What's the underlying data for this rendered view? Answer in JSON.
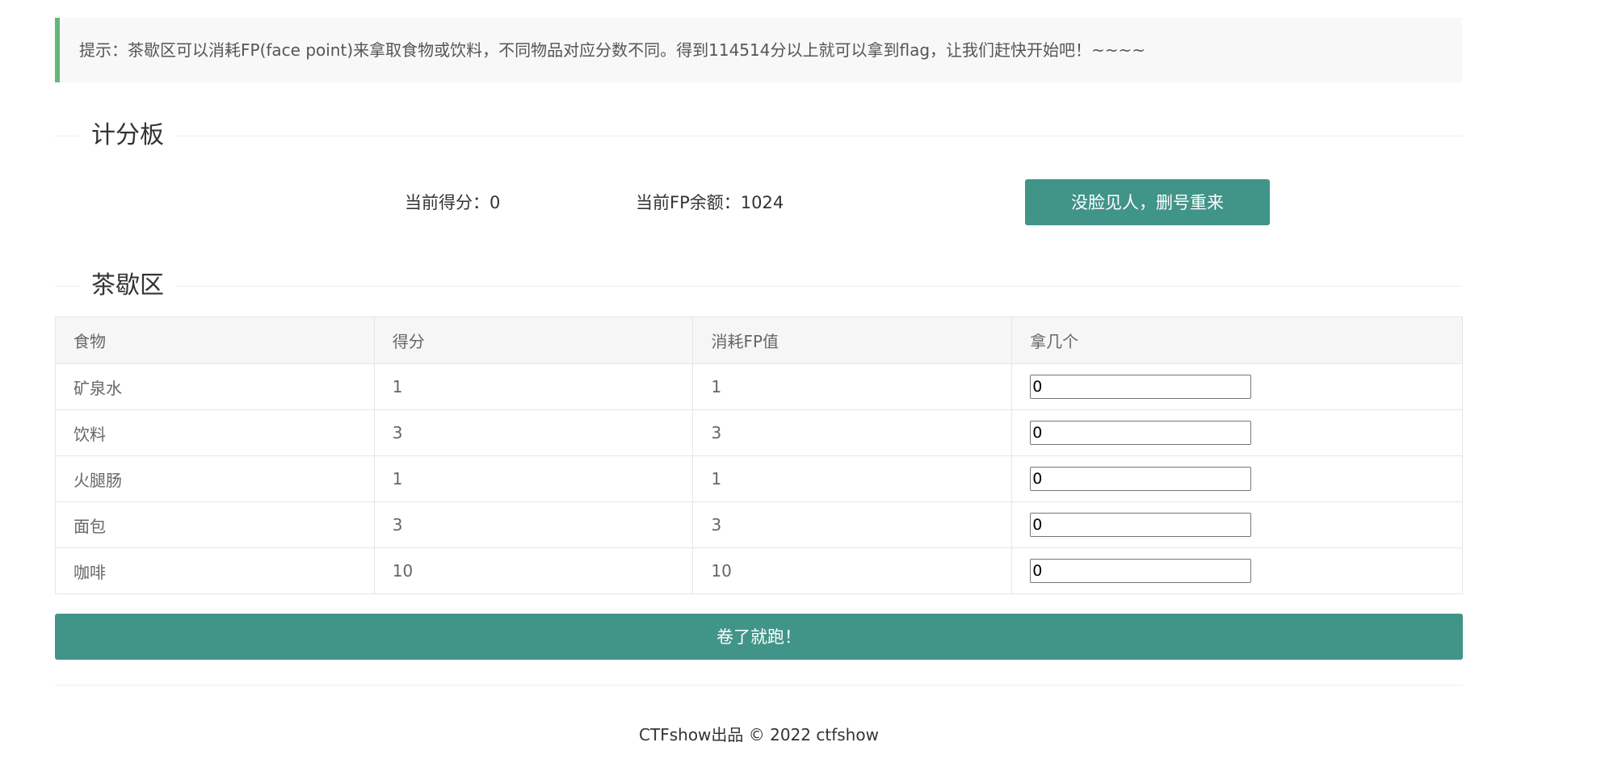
{
  "tip": {
    "text": "提示：茶歇区可以消耗FP(face point)来拿取食物或饮料，不同物品对应分数不同。得到114514分以上就可以拿到flag，让我们赶快开始吧！~~~~"
  },
  "scoreboard": {
    "title": "计分板",
    "current_score": "当前得分：0",
    "current_fp": "当前FP余额：1024",
    "reset_label": "没脸见人，删号重来"
  },
  "break_area": {
    "title": "茶歇区",
    "headers": [
      "食物",
      "得分",
      "消耗FP值",
      "拿几个"
    ],
    "rows": [
      {
        "food": "矿泉水",
        "score": "1",
        "fp": "1",
        "qty": "0"
      },
      {
        "food": "饮料",
        "score": "3",
        "fp": "3",
        "qty": "0"
      },
      {
        "food": "火腿肠",
        "score": "1",
        "fp": "1",
        "qty": "0"
      },
      {
        "food": "面包",
        "score": "3",
        "fp": "3",
        "qty": "0"
      },
      {
        "food": "咖啡",
        "score": "10",
        "fp": "10",
        "qty": "0"
      }
    ],
    "submit_label": "卷了就跑！"
  },
  "footer": {
    "text": "CTFshow出品 © 2022 ctfshow"
  },
  "colors": {
    "accent": "#419488",
    "tip_border": "#5fb878",
    "tip_background": "#f8f8f8"
  }
}
